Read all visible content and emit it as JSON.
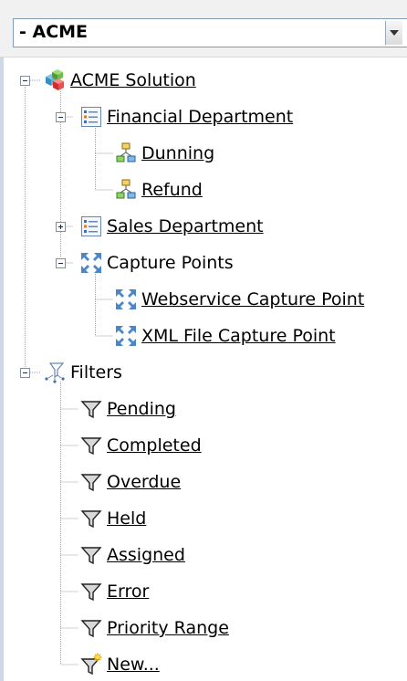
{
  "combo": {
    "value": "- ACME"
  },
  "tree": {
    "solution": "ACME Solution",
    "financial": "Financial Department",
    "dunning": "Dunning",
    "refund": "Refund",
    "sales": "Sales Department",
    "capture": "Capture Points",
    "webservice": "Webservice Capture Point",
    "xmlfile": "XML File Capture Point",
    "filters": "Filters",
    "filter_items": [
      "Pending",
      "Completed",
      "Overdue",
      "Held",
      "Assigned",
      "Error",
      "Priority Range",
      "New..."
    ]
  },
  "colors": {
    "tree_line": "#a0a0a0",
    "link": "#000000",
    "accent": "#7f9db9"
  },
  "icons": {
    "solution": "cubes-icon",
    "department": "list-document-icon",
    "workflow": "workflow-icon",
    "capture": "capture-arrows-icon",
    "filters": "filters-group-icon",
    "filter": "funnel-icon",
    "new_filter": "funnel-new-icon"
  }
}
